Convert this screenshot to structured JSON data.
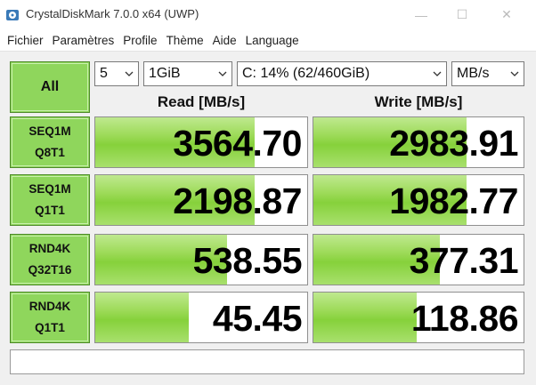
{
  "window": {
    "title": "CrystalDiskMark 7.0.0 x64 (UWP)",
    "controls": [
      "—",
      "☐",
      "✕"
    ]
  },
  "menu": [
    "Fichier",
    "Paramètres",
    "Profile",
    "Thème",
    "Aide",
    "Language"
  ],
  "toolbar": {
    "all_label": "All",
    "count": "5",
    "size": "1GiB",
    "drive": "C: 14% (62/460GiB)",
    "unit": "MB/s"
  },
  "headers": {
    "read": "Read [MB/s]",
    "write": "Write [MB/s]"
  },
  "tests": [
    {
      "line1": "SEQ1M",
      "line2": "Q8T1",
      "read": "3564.70",
      "write": "2983.91",
      "read_fill": 0.75,
      "write_fill": 0.73
    },
    {
      "line1": "SEQ1M",
      "line2": "Q1T1",
      "read": "2198.87",
      "write": "1982.77",
      "read_fill": 0.75,
      "write_fill": 0.73
    },
    {
      "line1": "RND4K",
      "line2": "Q32T16",
      "read": "538.55",
      "write": "377.31",
      "read_fill": 0.62,
      "write_fill": 0.6
    },
    {
      "line1": "RND4K",
      "line2": "Q1T1",
      "read": "45.45",
      "write": "118.86",
      "read_fill": 0.44,
      "write_fill": 0.49
    }
  ],
  "comment": "",
  "colors": {
    "accent_green": "#8fd65c",
    "bar_green": "#86d13b"
  }
}
